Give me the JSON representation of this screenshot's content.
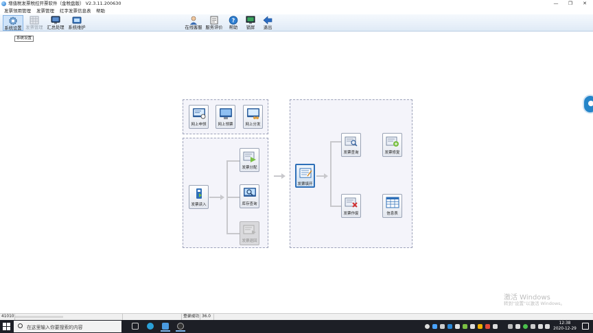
{
  "window": {
    "title": "增值税发票税控开票软件（金税盘版） V2.3.11.200630",
    "minimize_glyph": "—",
    "maximize_glyph": "❐",
    "close_glyph": "✕"
  },
  "menu": [
    "发票领用管理",
    "发票管理",
    "红字发票信息表",
    "帮助"
  ],
  "toolbar": {
    "left": [
      {
        "label": "系统设置",
        "icon": "gear-icon",
        "state": "hover"
      },
      {
        "label": "发票管理",
        "icon": "invoice-grid-icon",
        "state": "disabled"
      },
      {
        "label": "汇总处理",
        "icon": "monitor-icon",
        "state": "normal"
      },
      {
        "label": "系统维护",
        "icon": "maintenance-icon",
        "state": "normal"
      }
    ],
    "right": [
      {
        "label": "在线客服",
        "icon": "support-agent-icon"
      },
      {
        "label": "服务评价",
        "icon": "review-icon"
      },
      {
        "label": "帮助",
        "icon": "help-icon"
      },
      {
        "label": "锁屏",
        "icon": "lock-screen-icon"
      },
      {
        "label": "退出",
        "icon": "exit-arrow-icon"
      }
    ],
    "tooltip": "系统设置"
  },
  "flow": {
    "online": [
      {
        "label": "网上申领",
        "icon": "online-apply-icon"
      },
      {
        "label": "网上领票",
        "icon": "online-receive-icon"
      },
      {
        "label": "网上分发",
        "icon": "online-distribute-icon"
      }
    ],
    "read_in": {
      "label": "发票读入",
      "icon": "usb-read-icon"
    },
    "stock": [
      {
        "label": "发票分配",
        "icon": "allocate-icon",
        "state": "normal"
      },
      {
        "label": "库存查询",
        "icon": "stock-query-icon",
        "state": "normal"
      },
      {
        "label": "发票退回",
        "icon": "return-icon",
        "state": "disabled"
      }
    ],
    "fill": {
      "label": "发票填开",
      "icon": "invoice-fill-icon"
    },
    "after": [
      {
        "label": "发票查询",
        "icon": "invoice-query-icon"
      },
      {
        "label": "发票修复",
        "icon": "invoice-repair-icon"
      },
      {
        "label": "发票作废",
        "icon": "invoice-void-icon"
      },
      {
        "label": "信息表",
        "icon": "info-table-icon"
      }
    ]
  },
  "watermark": {
    "line1": "激活 Windows",
    "line2": "转到\"设置\"以激活 Windows。"
  },
  "statusbar": {
    "code": "41010",
    "status": "登录成功",
    "version": "36.0"
  },
  "taskbar": {
    "search_placeholder": "在这里输入你要搜索的内容",
    "time": "12:38",
    "date": "2020-12-29"
  },
  "colors": {
    "accent": "#2e6fb8",
    "toolbar_top": "#f5f9fd",
    "toolbar_bottom": "#dfeaf6",
    "group_bg": "#f4f4fa",
    "taskbar": "#1d1f26"
  }
}
